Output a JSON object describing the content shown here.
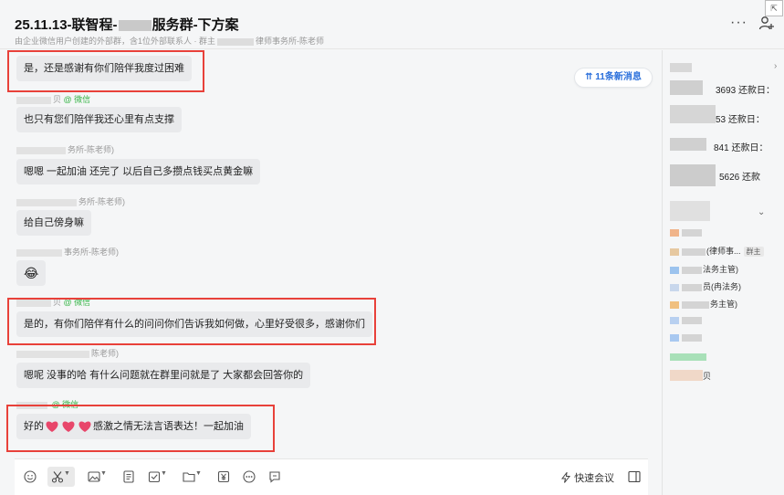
{
  "header": {
    "title_prefix": "25.11.13-联智程-",
    "title_suffix": "服务群-下方案",
    "subtitle_prefix": "由企业微信用户创建的外部群，含1位外部联系人 · 群主",
    "subtitle_suffix": "律师事务所-陈老师",
    "more_label": "···",
    "corner_label": "⇱"
  },
  "new_messages": "⇈ 11条新消息",
  "messages": [
    {
      "text": "是，还是感谢有你们陪伴我度过困难"
    },
    {
      "sender": "贝",
      "wechat": "@ 微信",
      "text": "也只有您们陪伴我还心里有点支撑"
    },
    {
      "sender": "务所-陈老师)",
      "text": "嗯嗯 一起加油 还完了 以后自己多攒点钱买点黄金嘛"
    },
    {
      "sender": "务所-陈老师)",
      "text": "给自己傍身嘛"
    },
    {
      "sender": "事务所-陈老师)",
      "text": "😂"
    },
    {
      "sender": "贝",
      "wechat": "@ 微信",
      "text": "是的，有你们陪伴有什么的问问你们告诉我如何做，心里好受很多，感谢你们"
    },
    {
      "sender": "陈老师)",
      "text": "嗯呢 没事的哈 有什么问题就在群里问就是了 大家都会回答你的"
    },
    {
      "sender": "",
      "wechat": "@ 微信",
      "text_prefix": "好的",
      "text_suffix": "感激之情无法言语表达！一起加油"
    }
  ],
  "right_panel": {
    "notices": [
      "3693  还款日：",
      "53  还款日：",
      "841  还款日：",
      "5626  还款"
    ],
    "arrow": "›",
    "collapse": "⌄",
    "members": [
      {
        "color": "#f0b48a",
        "label": ""
      },
      {
        "color": "#e6c8a0",
        "label": "(律师事...",
        "tag": "群主"
      },
      {
        "color": "#9cc3ee",
        "label": "法务主管)"
      },
      {
        "color": "#c8d7ec",
        "label": "员(冉法务)"
      },
      {
        "color": "#f0c080",
        "label": "务主管)"
      },
      {
        "color": "#b8d0f0",
        "label": ""
      },
      {
        "color": "#a8c8f0",
        "label": ""
      },
      {
        "color": "#a8e0b8",
        "label": ""
      },
      {
        "color": "#f0d8c8",
        "label": ""
      },
      {
        "color": "#e8e0d8",
        "label": "贝"
      }
    ]
  },
  "toolbar": {
    "meeting_label": "快速会议"
  },
  "colors": {
    "accent": "#2a6fdb",
    "highlight": "#e8413a",
    "wechat": "#3bb54a",
    "bubble": "#e9eaec"
  }
}
